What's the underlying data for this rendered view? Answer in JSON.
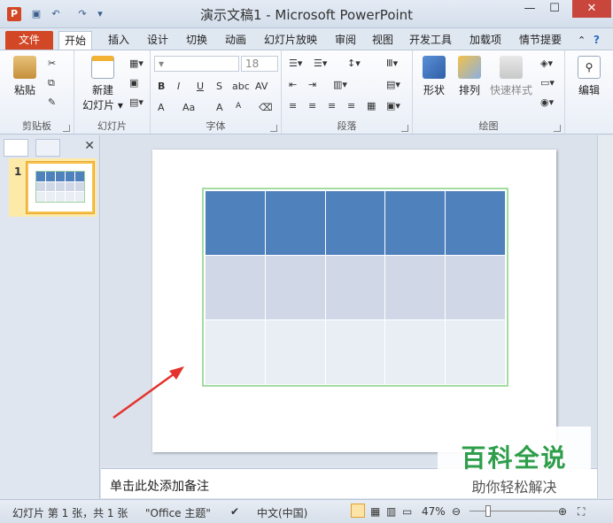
{
  "window": {
    "title": "演示文稿1 - Microsoft PowerPoint",
    "app_badge": "P",
    "min_symbol": "—",
    "max_symbol": "☐",
    "close_symbol": "✕"
  },
  "tabs": [
    {
      "label": "文件"
    },
    {
      "label": "开始"
    },
    {
      "label": "插入"
    },
    {
      "label": "设计"
    },
    {
      "label": "切换"
    },
    {
      "label": "动画"
    },
    {
      "label": "幻灯片放映"
    },
    {
      "label": "审阅"
    },
    {
      "label": "视图"
    },
    {
      "label": "开发工具"
    },
    {
      "label": "加载项"
    },
    {
      "label": "情节提要"
    }
  ],
  "ribbon": {
    "clipboard": {
      "label": "剪贴板",
      "paste": "粘贴"
    },
    "slides": {
      "label": "幻灯片",
      "new_slide_line1": "新建",
      "new_slide_line2": "幻灯片 ▾"
    },
    "font": {
      "label": "字体",
      "font_size": "18",
      "bold": "B",
      "italic": "I",
      "underline": "U",
      "strike": "S",
      "shadow": "abc",
      "spacing": "AV",
      "font_color": "A",
      "case": "Aa",
      "grow": "A",
      "shrink": "A"
    },
    "paragraph": {
      "label": "段落"
    },
    "drawing": {
      "label": "绘图",
      "shapes": "形状",
      "arrange": "排列",
      "quick_styles": "快速样式"
    },
    "editing": {
      "label": "编辑"
    }
  },
  "slides_pane": {
    "slide_number": "1",
    "close_symbol": "✕"
  },
  "notes": {
    "placeholder": "单击此处添加备注"
  },
  "status": {
    "slide_info": "幻灯片 第 1 张，共 1 张",
    "theme": "\"Office 主题\"",
    "language": "中文(中国)",
    "zoom": "47%",
    "zoom_fraction": 0.47
  },
  "watermark": {
    "title": "百科全说",
    "subtitle": "助你轻松解决"
  },
  "colors": {
    "table_header": "#4f81bd",
    "table_band1": "#d0d8e8",
    "table_band2": "#e9edf4",
    "table_border": "#a4dca4",
    "file_tab": "#d24726",
    "arrow": "#e5322d",
    "watermark": "#2e9e4a"
  }
}
